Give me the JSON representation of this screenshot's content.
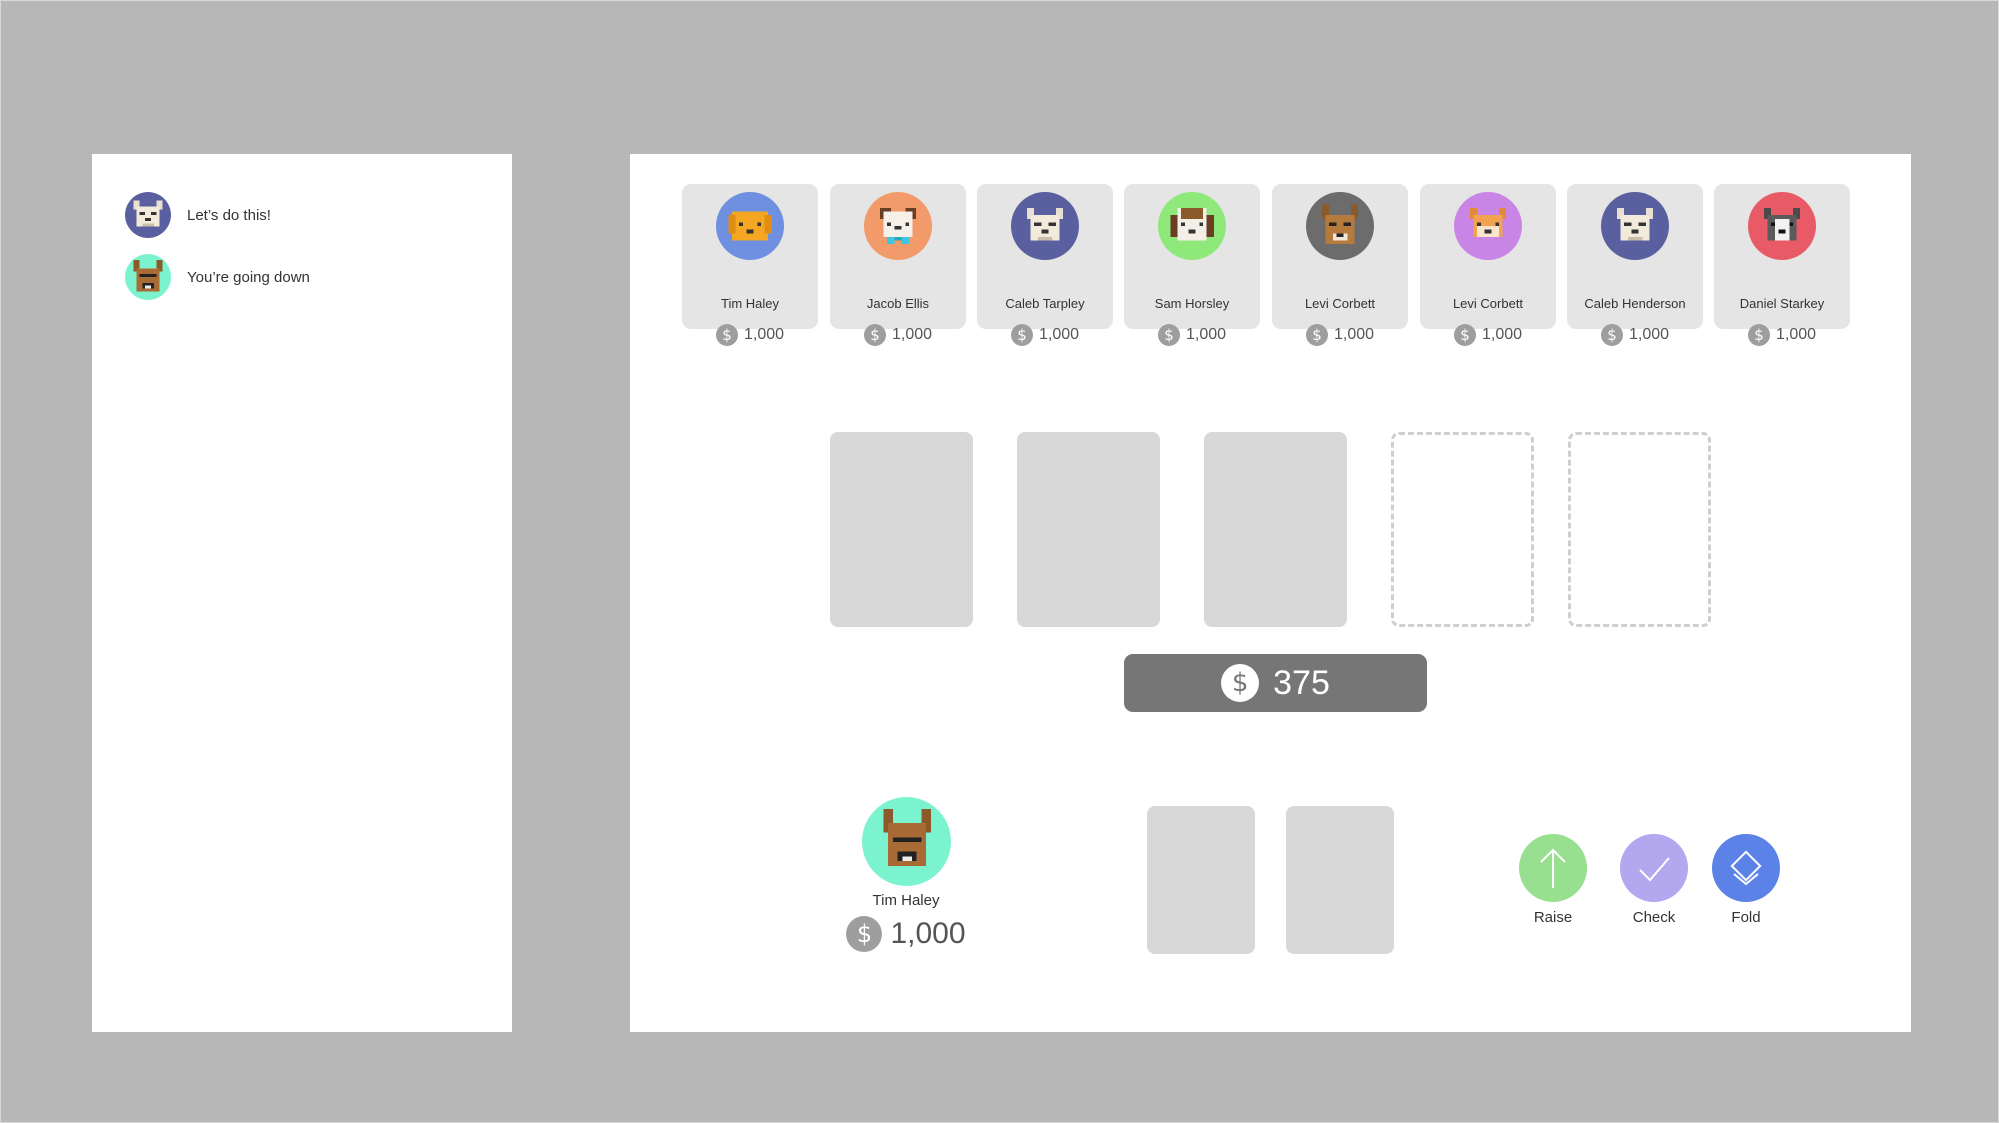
{
  "chat": {
    "messages": [
      {
        "avatar": "wolf-gray-avatar",
        "avatar_bg": "#5a5fa0",
        "text": "Let’s do this!"
      },
      {
        "avatar": "german-shepherd-avatar",
        "avatar_bg": "#7cf3cf",
        "text": "You’re going down"
      }
    ]
  },
  "players": [
    {
      "name": "Tim Haley",
      "chips": "1,000",
      "avatar": "golden-retriever-avatar",
      "avatar_bg": "#6f8fe0"
    },
    {
      "name": "Jacob Ellis",
      "chips": "1,000",
      "avatar": "pug-bowtie-avatar",
      "avatar_bg": "#f39a6b"
    },
    {
      "name": "Caleb Tarpley",
      "chips": "1,000",
      "avatar": "wolf-gray-avatar",
      "avatar_bg": "#5a5fa0"
    },
    {
      "name": "Sam Horsley",
      "chips": "1,000",
      "avatar": "beagle-avatar",
      "avatar_bg": "#8fe87a"
    },
    {
      "name": "Levi Corbett",
      "chips": "1,000",
      "avatar": "shepherd-dark-avatar",
      "avatar_bg": "#6c6c6c"
    },
    {
      "name": "Levi Corbett",
      "chips": "1,000",
      "avatar": "fox-avatar",
      "avatar_bg": "#c985e6"
    },
    {
      "name": "Caleb Henderson",
      "chips": "1,000",
      "avatar": "wolf-gray-avatar",
      "avatar_bg": "#5a5fa0"
    },
    {
      "name": "Daniel Starkey",
      "chips": "1,000",
      "avatar": "husky-avatar",
      "avatar_bg": "#e85a66"
    }
  ],
  "community_cards": [
    {
      "state": "dealt"
    },
    {
      "state": "dealt"
    },
    {
      "state": "dealt"
    },
    {
      "state": "empty"
    },
    {
      "state": "empty"
    }
  ],
  "pot": {
    "currency_icon": "dollar-icon",
    "value": "375"
  },
  "hero": {
    "name": "Tim Haley",
    "chips": "1,000",
    "avatar": "german-shepherd-avatar",
    "avatar_bg": "#7cf3cf",
    "hole_cards": 2
  },
  "actions": [
    {
      "label": "Raise",
      "icon": "arrow-up-icon",
      "color": "#98e08f"
    },
    {
      "label": "Check",
      "icon": "checkmark-icon",
      "color": "#b3a7ef"
    },
    {
      "label": "Fold",
      "icon": "fold-cards-icon",
      "color": "#5b82e6"
    }
  ]
}
